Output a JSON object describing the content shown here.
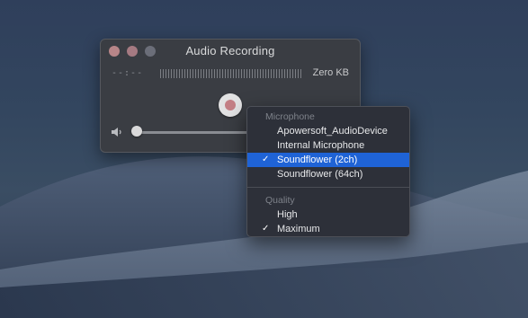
{
  "window": {
    "title": "Audio Recording",
    "time_readout": "--:--",
    "file_size": "Zero KB",
    "volume_level": 0.0
  },
  "menu": {
    "microphone_header": "Microphone",
    "microphone_items": [
      {
        "label": "Apowersoft_AudioDevice",
        "checked": false,
        "highlighted": false
      },
      {
        "label": "Internal Microphone",
        "checked": false,
        "highlighted": false
      },
      {
        "label": "Soundflower (2ch)",
        "checked": true,
        "highlighted": true
      },
      {
        "label": "Soundflower (64ch)",
        "checked": false,
        "highlighted": false
      }
    ],
    "quality_header": "Quality",
    "quality_items": [
      {
        "label": "High",
        "checked": false
      },
      {
        "label": "Maximum",
        "checked": true
      }
    ],
    "checkmark_glyph": "✓"
  },
  "colors": {
    "highlight": "#1f63d6",
    "record_dot": "#c47f85"
  }
}
